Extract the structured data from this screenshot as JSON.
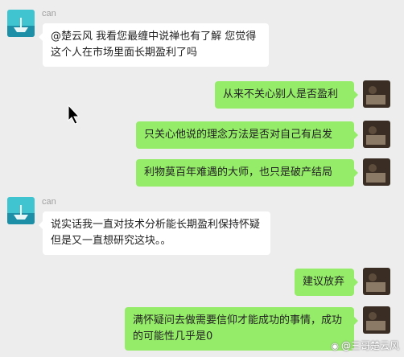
{
  "participants": {
    "left": {
      "name": "can",
      "avatar_icon": "sea-boat-avatar-icon"
    },
    "right": {
      "avatar_icon": "dark-photo-avatar-icon"
    }
  },
  "messages": [
    {
      "side": "left",
      "name": "can",
      "text": "@楚云风 我看您最缠中说禅也有了解 您觉得这个人在市场里面长期盈利了吗"
    },
    {
      "side": "right",
      "text": "从来不关心别人是否盈利"
    },
    {
      "side": "right",
      "text": "只关心他说的理念方法是否对自己有启发"
    },
    {
      "side": "right",
      "text": "利物莫百年难遇的大师，也只是破产结局"
    },
    {
      "side": "left",
      "name": "can",
      "text": "说实话我一直对技术分析能长期盈利保持怀疑 但是又一直想研究这块。。"
    },
    {
      "side": "right",
      "text": "建议放弃"
    },
    {
      "side": "right",
      "text": "满怀疑问去做需要信仰才能成功的事情，成功的可能性几乎是0"
    }
  ],
  "watermark": {
    "text": "@三哥楚云风",
    "icon": "weibo-logo-icon"
  },
  "colors": {
    "background": "#ededed",
    "incoming_bubble": "#ffffff",
    "outgoing_bubble": "#95ec69"
  }
}
